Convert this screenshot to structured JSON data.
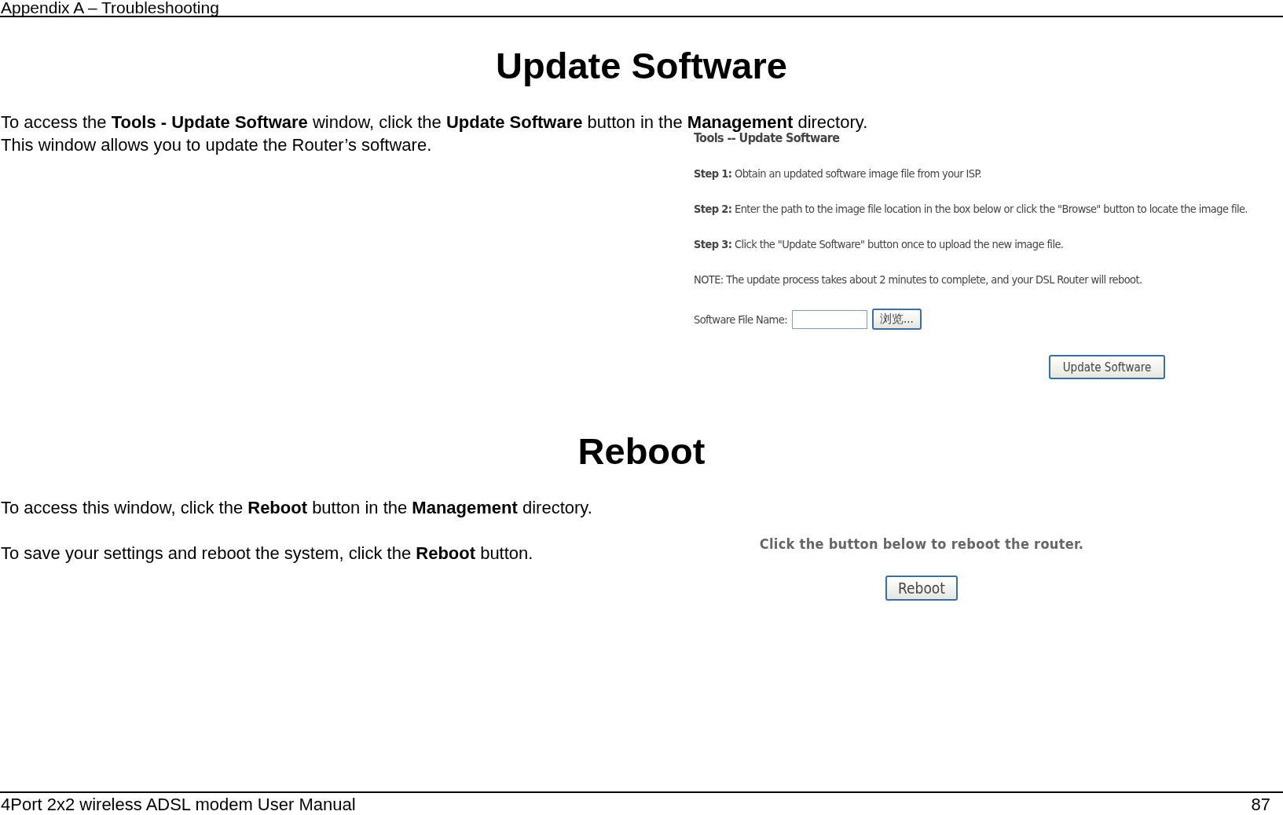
{
  "header": "Appendix A – Troubleshooting",
  "sections": [
    {
      "title": "Update Software",
      "paragraphs": [
        "To access the **Tools - Update Software** window, click the **Update Software** button in the **Management** directory.",
        "This window allows you to update the Router’s software."
      ],
      "screen": {
        "kind": "update",
        "title": "Tools -- Update Software",
        "steps": [
          {
            "label": "Step 1:",
            "text": "Obtain an updated software image file from your ISP."
          },
          {
            "label": "Step 2:",
            "text": "Enter the path to the image file location in the box below or click the \"Browse\" button to locate the image file."
          },
          {
            "label": "Step 3:",
            "text": "Click the \"Update Software\" button once to upload the new image file."
          }
        ],
        "note": "NOTE: The update process takes about 2 minutes to complete, and your DSL Router will reboot.",
        "field_label": "Software File Name:",
        "browse_button": "浏览...",
        "submit_button": "Update Software"
      }
    },
    {
      "title": "Reboot",
      "paragraphs": [
        "To access this window, click the **Reboot** button in the **Management** directory.",
        "To save your settings and reboot the system, click the **Reboot** button."
      ],
      "screen": {
        "kind": "reboot",
        "message": "Click the button below to reboot the router.",
        "submit_button": "Reboot"
      }
    }
  ],
  "footer": {
    "title": "4Port 2x2 wireless ADSL modem User Manual",
    "page": "87"
  }
}
